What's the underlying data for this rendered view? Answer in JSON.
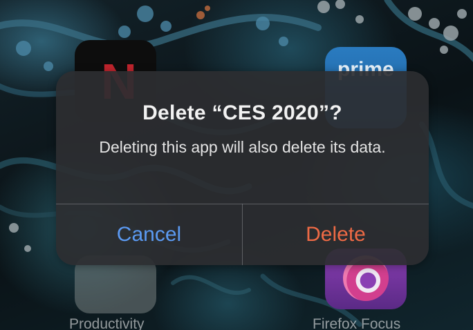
{
  "dialog": {
    "title": "Delete “CES 2020”?",
    "message": "Deleting this app will also delete its data.",
    "buttons": {
      "cancel_label": "Cancel",
      "delete_label": "Delete"
    }
  },
  "home_screen": {
    "apps": [
      {
        "label": "Productivity",
        "icon": "folder-icon"
      },
      {
        "label": "Firefox Focus",
        "icon": "firefox-focus-icon"
      },
      {
        "label": "",
        "icon": "netflix-icon",
        "glyph": "N"
      },
      {
        "label": "",
        "icon": "prime-video-icon",
        "glyph": "prime"
      }
    ]
  },
  "colors": {
    "cancel": "#5b9af2",
    "delete": "#ee6a45",
    "dialog_bg": "#2c2e31"
  }
}
